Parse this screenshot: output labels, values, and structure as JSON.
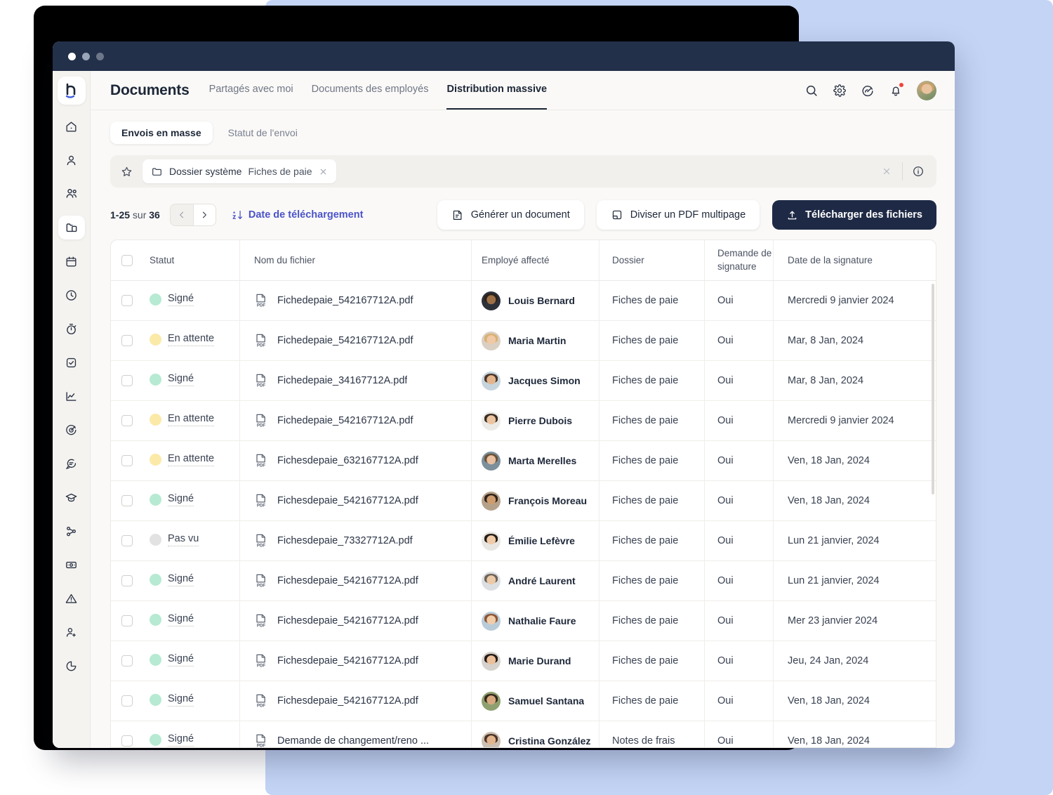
{
  "window": {
    "dots": [
      "close",
      "minimize",
      "maximize"
    ]
  },
  "header": {
    "title": "Documents",
    "tabs": [
      {
        "label": "Partagés avec moi",
        "active": false
      },
      {
        "label": "Documents des employés",
        "active": false
      },
      {
        "label": "Distribution massive",
        "active": true
      }
    ],
    "actions": [
      {
        "icon": "search-icon",
        "name": "search"
      },
      {
        "icon": "gear-icon",
        "name": "settings"
      },
      {
        "icon": "speedometer-icon",
        "name": "performance"
      },
      {
        "icon": "bell-icon",
        "name": "notifications",
        "badge": true
      }
    ],
    "avatar": "user-avatar"
  },
  "sidebar": {
    "logo": "factorial-logo",
    "items": [
      {
        "icon": "home-icon",
        "name": "home",
        "active": false
      },
      {
        "icon": "person-icon",
        "name": "profile",
        "active": false
      },
      {
        "icon": "people-icon",
        "name": "employees",
        "active": false
      },
      {
        "icon": "folder-icon",
        "name": "documents",
        "active": true
      },
      {
        "icon": "calendar-icon",
        "name": "calendar",
        "active": false
      },
      {
        "icon": "clock-icon",
        "name": "time",
        "active": false
      },
      {
        "icon": "stopwatch-icon",
        "name": "timetracking",
        "active": false
      },
      {
        "icon": "task-check-icon",
        "name": "tasks",
        "active": false
      },
      {
        "icon": "chart-line-icon",
        "name": "analytics",
        "active": false
      },
      {
        "icon": "target-icon",
        "name": "goals",
        "active": false
      },
      {
        "icon": "chat-icon",
        "name": "messages",
        "active": false
      },
      {
        "icon": "graduation-icon",
        "name": "training",
        "active": false
      },
      {
        "icon": "workflow-icon",
        "name": "workflows",
        "active": false
      },
      {
        "icon": "money-icon",
        "name": "payroll",
        "active": false
      },
      {
        "icon": "alert-icon",
        "name": "alerts",
        "active": false
      },
      {
        "icon": "user-add-icon",
        "name": "recruitment",
        "active": false
      },
      {
        "icon": "pie-chart-icon",
        "name": "reports",
        "active": false
      }
    ]
  },
  "segmented": {
    "items": [
      {
        "label": "Envois en masse",
        "active": true
      },
      {
        "label": "Statut de l'envoi",
        "active": false
      }
    ]
  },
  "filterbar": {
    "favorite_icon": "star-icon",
    "chip": {
      "folder_icon": "folder-icon",
      "label": "Dossier système",
      "value": "Fiches de paie",
      "close_icon": "close-icon"
    },
    "clear_icon": "close-icon",
    "info_icon": "info-icon"
  },
  "toolbar": {
    "range": "1-25",
    "of_word": "sur",
    "total": "36",
    "prev_icon": "chevron-left-icon",
    "next_icon": "chevron-right-icon",
    "sort_icon": "sort-az-icon",
    "sort_label": "Date de téléchargement",
    "generate_label": "Générer un document",
    "generate_icon": "document-icon",
    "split_label": "Diviser un PDF multipage",
    "split_icon": "document-split-icon",
    "upload_label": "Télécharger des fichiers",
    "upload_icon": "upload-icon"
  },
  "table": {
    "columns": [
      "Statut",
      "Nom du fichier",
      "Employé affecté",
      "Dossier",
      "Demande de signature",
      "Date de la signature"
    ],
    "rows": [
      {
        "status": "Signé",
        "status_color": "#b6ead2",
        "file": "Fichedepaie_542167712A.pdf",
        "employee": "Louis Bernard",
        "skin": "#9d7048",
        "hair": "#2c2119",
        "bg": "#2c3039",
        "folder": "Fiches de paie",
        "signature": "Oui",
        "date": "Mercredi 9 janvier 2024"
      },
      {
        "status": "En attente",
        "status_color": "#fbe9a8",
        "file": "Fichedepaie_542167712A.pdf",
        "employee": "Maria Martin",
        "skin": "#f0c9a6",
        "hair": "#d8b070",
        "bg": "#d9cfc2",
        "folder": "Fiches de paie",
        "signature": "Oui",
        "date": "Mar, 8 Jan, 2024"
      },
      {
        "status": "Signé",
        "status_color": "#b6ead2",
        "file": "Fichedepaie_34167712A.pdf",
        "employee": "Jacques Simon",
        "skin": "#e4b58c",
        "hair": "#4a3527",
        "bg": "#c6d4dd",
        "folder": "Fiches de paie",
        "signature": "Oui",
        "date": "Mar, 8 Jan, 2024"
      },
      {
        "status": "En attente",
        "status_color": "#fbe9a8",
        "file": "Fichedepaie_542167712A.pdf",
        "employee": "Pierre Dubois",
        "skin": "#ecc4a0",
        "hair": "#3a2d22",
        "bg": "#eceae6",
        "folder": "Fiches de paie",
        "signature": "Oui",
        "date": "Mercredi 9 janvier 2024"
      },
      {
        "status": "En attente",
        "status_color": "#fbe9a8",
        "file": "Fichesdepaie_632167712A.pdf",
        "employee": "Marta Merelles",
        "skin": "#e9c0a0",
        "hair": "#6b5036",
        "bg": "#7c8f9a",
        "folder": "Fiches de paie",
        "signature": "Oui",
        "date": "Ven, 18 Jan, 2024"
      },
      {
        "status": "Signé",
        "status_color": "#b6ead2",
        "file": "Fichesdepaie_542167712A.pdf",
        "employee": "François Moreau",
        "skin": "#cf9c6f",
        "hair": "#2e2118",
        "bg": "#b5a18a",
        "folder": "Fiches de paie",
        "signature": "Oui",
        "date": "Ven, 18 Jan, 2024"
      },
      {
        "status": "Pas vu",
        "status_color": "#e2e2e2",
        "file": "Fichesdepaie_73327712A.pdf",
        "employee": "Émilie Lefèvre",
        "skin": "#f0cba8",
        "hair": "#241c16",
        "bg": "#e8e6e2",
        "folder": "Fiches de paie",
        "signature": "Oui",
        "date": "Lun 21 janvier, 2024"
      },
      {
        "status": "Signé",
        "status_color": "#b6ead2",
        "file": "Fichesdepaie_542167712A.pdf",
        "employee": "André Laurent",
        "skin": "#eccaa8",
        "hair": "#6d6258",
        "bg": "#dcdfe2",
        "folder": "Fiches de paie",
        "signature": "Oui",
        "date": "Lun 21 janvier, 2024"
      },
      {
        "status": "Signé",
        "status_color": "#b6ead2",
        "file": "Fichesdepaie_542167712A.pdf",
        "employee": "Nathalie Faure",
        "skin": "#f2cdaa",
        "hair": "#8c5434",
        "bg": "#b9cbd8",
        "folder": "Fiches de paie",
        "signature": "Oui",
        "date": "Mer 23 janvier 2024"
      },
      {
        "status": "Signé",
        "status_color": "#b6ead2",
        "file": "Fichesdepaie_542167712A.pdf",
        "employee": "Marie Durand",
        "skin": "#ecc09a",
        "hair": "#231a14",
        "bg": "#d5d2cd",
        "folder": "Fiches de paie",
        "signature": "Oui",
        "date": "Jeu, 24 Jan, 2024"
      },
      {
        "status": "Signé",
        "status_color": "#b6ead2",
        "file": "Fichesdepaie_542167712A.pdf",
        "employee": "Samuel Santana",
        "skin": "#d8a97f",
        "hair": "#33281d",
        "bg": "#8fa070",
        "folder": "Fiches de paie",
        "signature": "Oui",
        "date": "Ven, 18 Jan, 2024"
      },
      {
        "status": "Signé",
        "status_color": "#b6ead2",
        "file": "Demande de changement/reno ...",
        "employee": "Cristina González",
        "skin": "#e3b58e",
        "hair": "#4b3226",
        "bg": "#cbbfb2",
        "folder": "Notes de frais",
        "signature": "Oui",
        "date": "Ven, 18 Jan, 2024"
      }
    ]
  },
  "colors": {
    "accent_dark": "#1e2a45",
    "link": "#4b53c9",
    "signed": "#b6ead2",
    "pending": "#fbe9a8",
    "unseen": "#e2e2e2",
    "notification": "#f0443c",
    "backdrop_blue": "#c3d4f5",
    "titlebar": "#22304a"
  }
}
